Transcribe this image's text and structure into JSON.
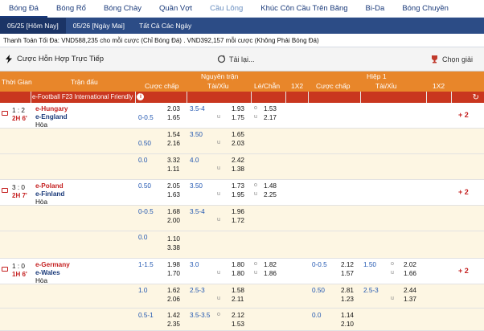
{
  "nav": {
    "sports": [
      "Bóng Đá",
      "Bóng Rổ",
      "Bóng Chày",
      "Quần Vợt",
      "Cầu Lông",
      "Khúc Côn Cầu Trên Băng",
      "Bi-Da",
      "Bóng Chuyền"
    ]
  },
  "dates": [
    "05/25 [Hôm Nay]",
    "05/26 [Ngày Mai]",
    "Tất Cả Các Ngày"
  ],
  "payout_text": "Thanh Toán Tối Đa: VND588,235 cho mỗi cược (Chỉ Bóng Đá) . VND392,157 mỗi cược (Không Phải Bóng Đá)",
  "toolbar": {
    "title": "Cược Hỗn Hợp Trực Tiếp",
    "refresh": "Tải lại...",
    "choose": "Chọn giải"
  },
  "header": {
    "time": "Thời Gian",
    "match": "Trận đấu",
    "fulltime": "Nguyên trận",
    "half": "Hiệp 1",
    "handicap": "Cược chấp",
    "overunder": "Tài/Xỉu",
    "oddeven": "Lẻ/Chẵn",
    "onextwo": "1X2",
    "handicap2": "Cược chấp",
    "overunder2": "Tài/Xỉu",
    "onextwo2": "1X2"
  },
  "league": {
    "name": "e-Football F23 International Friendly"
  },
  "labels": {
    "u": "u",
    "o": "o"
  },
  "matches": [
    {
      "score": "1 : 2",
      "clock": "2H 6'",
      "home": "e-Hungary",
      "away": "e-England",
      "draw": "Hòa",
      "more": "+ 2",
      "lines": [
        {
          "hcp": "0-0.5",
          "h1": "2.03",
          "h2": "1.65",
          "ou": "3.5-4",
          "o1": "1.93",
          "o2": "1.75",
          "oe1": "1.53",
          "oe2": "2.17"
        },
        {
          "hcp": "0.50",
          "h1": "1.54",
          "h2": "2.16",
          "ou": "3.50",
          "o1": "1.65",
          "o2": "2.03"
        },
        {
          "hcp": "0.0",
          "h1": "3.32",
          "h2": "1.11",
          "ou": "4.0",
          "o1": "2.42",
          "o2": "1.38"
        }
      ]
    },
    {
      "score": "3 : 0",
      "clock": "2H 7'",
      "home": "e-Poland",
      "away": "e-Finland",
      "draw": "Hòa",
      "more": "+ 2",
      "lines": [
        {
          "hcp": "0.50",
          "h1": "2.05",
          "h2": "1.63",
          "ou": "3.50",
          "o1": "1.73",
          "o2": "1.95",
          "oe1": "1.48",
          "oe2": "2.25"
        },
        {
          "hcp": "0-0.5",
          "h1": "1.68",
          "h2": "2.00",
          "ou": "3.5-4",
          "o1": "1.96",
          "o2": "1.72"
        },
        {
          "hcp": "0.0",
          "h1": "1.10",
          "h2": "3.38"
        }
      ]
    },
    {
      "score": "1 : 0",
      "clock": "1H 6'",
      "home": "e-Germany",
      "away": "e-Wales",
      "draw": "Hòa",
      "more": "+ 2",
      "lines": [
        {
          "hcp": "1-1.5",
          "h1": "1.98",
          "h2": "1.70",
          "ou": "3.0",
          "o1": "1.80",
          "o2": "1.80",
          "oe1": "1.82",
          "oe2": "1.86",
          "hhcp": "0-0.5",
          "hh1": "2.12",
          "hh2": "1.57",
          "hou": "1.50",
          "ho1": "2.02",
          "ho2": "1.66"
        },
        {
          "hcp": "1.0",
          "h1": "1.62",
          "h2": "2.06",
          "ou": "2.5-3",
          "o1": "1.58",
          "o2": "2.11",
          "hhcp": "0.50",
          "hh1": "2.81",
          "hh2": "1.23",
          "hou": "2.5-3",
          "ho1": "2.44",
          "ho2": "1.37"
        },
        {
          "hcp": "0.5-1",
          "h1": "1.42",
          "h2": "2.35",
          "ou": "3.5-3.5",
          "o1": "2.12",
          "o2": "1.53",
          "hhcp": "0.0",
          "hh1": "1.14",
          "hh2": "2.10"
        }
      ]
    }
  ]
}
